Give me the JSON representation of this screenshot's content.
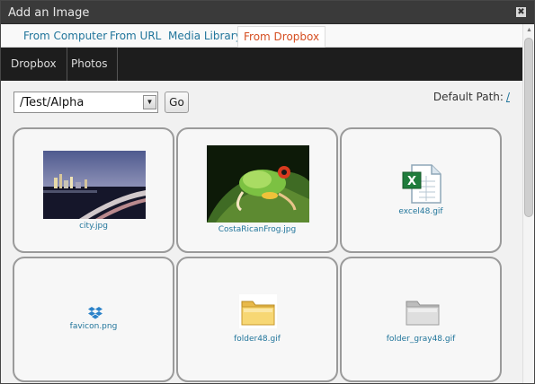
{
  "window": {
    "title": "Add an Image",
    "close_glyph": "✖"
  },
  "media_tabs": [
    {
      "label": "From Computer",
      "active": false
    },
    {
      "label": "From URL",
      "active": false
    },
    {
      "label": "Media Library",
      "active": false
    },
    {
      "label": "From Dropbox",
      "active": true
    }
  ],
  "subnav": [
    {
      "label": "Dropbox"
    },
    {
      "label": "Photos"
    }
  ],
  "toolbar": {
    "path_value": "/Test/Alpha",
    "go_label": "Go",
    "default_path_label": "Default Path:",
    "default_path_value": "/"
  },
  "files": [
    {
      "name": "city.jpg",
      "icon": "city-photo-thumbnail"
    },
    {
      "name": "CostaRicanFrog.jpg",
      "icon": "frog-photo-thumbnail"
    },
    {
      "name": "excel48.gif",
      "icon": "excel-file-icon"
    },
    {
      "name": "favicon.png",
      "icon": "dropbox-logo-icon"
    },
    {
      "name": "folder48.gif",
      "icon": "yellow-folder-icon"
    },
    {
      "name": "folder_gray48.gif",
      "icon": "gray-folder-icon"
    }
  ],
  "colors": {
    "link": "#21759b",
    "active_tab": "#d54e21",
    "subnav_bg": "#1d1d1d",
    "titlebar_bg": "#3a3a3a"
  }
}
